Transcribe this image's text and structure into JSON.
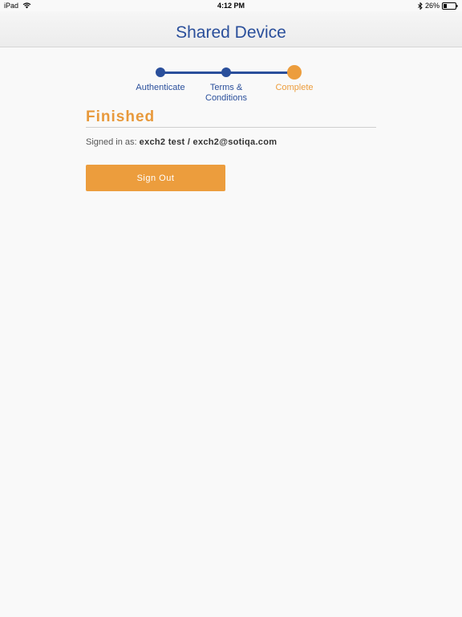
{
  "status_bar": {
    "device": "iPad",
    "time": "4:12 PM",
    "battery": "26%"
  },
  "nav": {
    "title": "Shared Device"
  },
  "stepper": {
    "steps": [
      {
        "label": "Authenticate",
        "state": "done"
      },
      {
        "label": "Terms &\nConditions",
        "state": "done"
      },
      {
        "label": "Complete",
        "state": "current"
      }
    ]
  },
  "content": {
    "heading": "Finished",
    "signed_in_prefix": "Signed in as: ",
    "signed_in_user": "exch2 test / exch2@sotiqa.com",
    "sign_out_label": "Sign Out"
  },
  "colors": {
    "primary_blue": "#2a4f9b",
    "accent_orange": "#ec9d3d"
  }
}
